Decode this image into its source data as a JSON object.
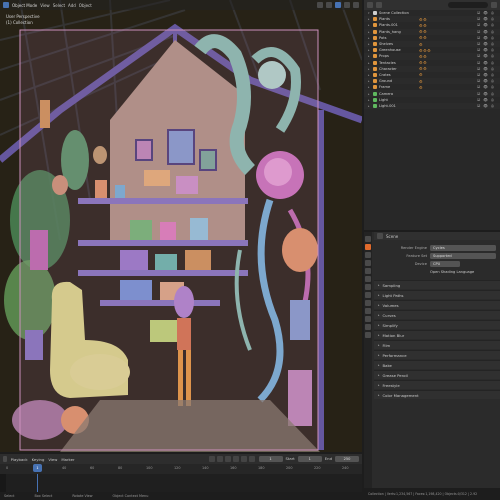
{
  "viewport": {
    "mode": "Object Mode",
    "menus": [
      "View",
      "Select",
      "Add",
      "Object"
    ],
    "info_lines": [
      "User Perspective",
      "(1) Collection"
    ]
  },
  "outliner": {
    "search_placeholder": "",
    "items": [
      {
        "label": "Scene Collection",
        "mods": "",
        "selected": false,
        "color": "#cfcfcf"
      },
      {
        "label": "Plants",
        "mods": "⚙⚙",
        "selected": false,
        "color": "#e0953c"
      },
      {
        "label": "Plants.001",
        "mods": "⚙⚙",
        "selected": false,
        "color": "#e0953c"
      },
      {
        "label": "Plants_hang",
        "mods": "⚙⚙",
        "selected": false,
        "color": "#e0953c"
      },
      {
        "label": "Pots",
        "mods": "⚙⚙",
        "selected": false,
        "color": "#e0953c"
      },
      {
        "label": "Shelves",
        "mods": "⚙",
        "selected": false,
        "color": "#e0953c"
      },
      {
        "label": "Greenhouse",
        "mods": "⚙⚙⚙",
        "selected": false,
        "color": "#e0953c"
      },
      {
        "label": "Props",
        "mods": "⚙⚙",
        "selected": false,
        "color": "#e0953c"
      },
      {
        "label": "Tentacles",
        "mods": "⚙⚙",
        "selected": false,
        "color": "#e0953c"
      },
      {
        "label": "Character",
        "mods": "⚙⚙",
        "selected": true,
        "color": "#e0953c"
      },
      {
        "label": "Crates",
        "mods": "⚙",
        "selected": false,
        "color": "#e0953c"
      },
      {
        "label": "Ground",
        "mods": "⚙",
        "selected": false,
        "color": "#e0953c"
      },
      {
        "label": "Frame",
        "mods": "⚙",
        "selected": false,
        "color": "#e0953c"
      },
      {
        "label": "Camera",
        "mods": "",
        "selected": false,
        "color": "#5fb85f"
      },
      {
        "label": "Light",
        "mods": "",
        "selected": false,
        "color": "#5fb85f"
      },
      {
        "label": "Light.001",
        "mods": "",
        "selected": false,
        "color": "#5fb85f"
      }
    ]
  },
  "properties": {
    "header": "Scene",
    "fields": [
      {
        "k": "Render Engine",
        "v": "Cycles"
      },
      {
        "k": "Feature Set",
        "v": "Supported"
      },
      {
        "k": "Device",
        "v": "CPU"
      }
    ],
    "note": "Open Shading Language",
    "panels": [
      "Sampling",
      "Light Paths",
      "Volumes",
      "Curves",
      "Simplify",
      "Motion Blur",
      "Film",
      "Performance",
      "Bake",
      "Grease Pencil",
      "Freestyle",
      "Color Management"
    ]
  },
  "timeline": {
    "menus": [
      "Playback",
      "Keying",
      "View",
      "Marker"
    ],
    "current_frame": "1",
    "start_label": "Start",
    "start_value": "1",
    "end_label": "End",
    "end_value": "250",
    "ticks": [
      "0",
      "20",
      "40",
      "60",
      "80",
      "100",
      "120",
      "140",
      "160",
      "180",
      "200",
      "220",
      "240"
    ]
  },
  "bottom_hints": [
    "Select",
    "Box Select",
    "Rotate View",
    "Object Context Menu"
  ],
  "status": "Collection | Verts:1,234,567 | Faces:1,198,420 | Objects:0/312 | 2.92"
}
